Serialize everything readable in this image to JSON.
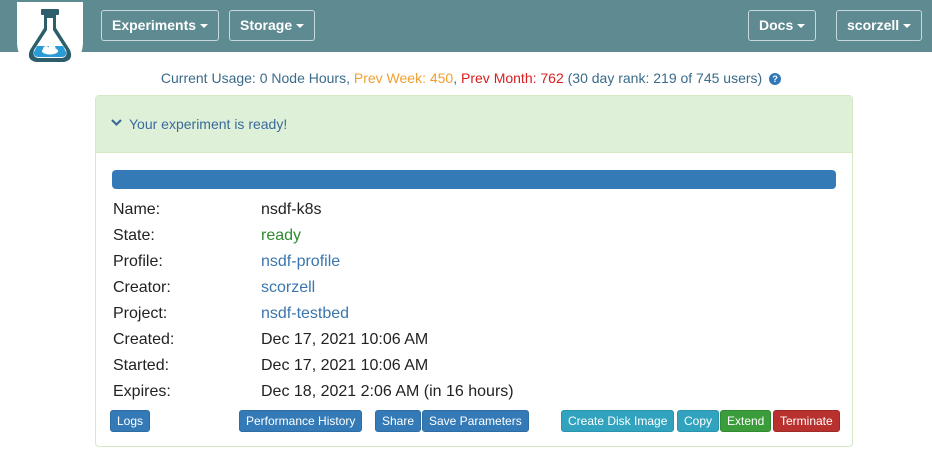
{
  "nav": {
    "experiments": "Experiments",
    "storage": "Storage",
    "docs": "Docs",
    "user": "scorzell"
  },
  "usage": {
    "current": "Current Usage: 0 Node Hours,",
    "prev_week": "Prev Week: 450",
    "prev_month": "Prev Month: 762",
    "rank": "(30 day rank: 219 of 745 users)"
  },
  "panel": {
    "status_title": "Your experiment is ready!",
    "progress_fraction": 1.0
  },
  "details": [
    {
      "label": "Name:",
      "value": "nsdf-k8s",
      "kind": "plain"
    },
    {
      "label": "State:",
      "value": "ready",
      "kind": "green"
    },
    {
      "label": "Profile:",
      "value": "nsdf-profile",
      "kind": "link"
    },
    {
      "label": "Creator:",
      "value": "scorzell",
      "kind": "link"
    },
    {
      "label": "Project:",
      "value": "nsdf-testbed",
      "kind": "link"
    },
    {
      "label": "Created:",
      "value": "Dec 17, 2021 10:06 AM",
      "kind": "plain"
    },
    {
      "label": "Started:",
      "value": "Dec 17, 2021 10:06 AM",
      "kind": "plain"
    },
    {
      "label": "Expires:",
      "value": "Dec 18, 2021 2:06 AM (in 16 hours)",
      "kind": "plain"
    }
  ],
  "actions": {
    "logs": "Logs",
    "performance_history": "Performance History",
    "share": "Share",
    "save_parameters": "Save Parameters",
    "create_disk_image": "Create Disk Image",
    "copy": "Copy",
    "extend": "Extend",
    "terminate": "Terminate"
  },
  "colors": {
    "navbar": "#5e8a91",
    "primary": "#337ab7",
    "info": "#31a3be",
    "success": "#3a9c3a",
    "danger": "#b8312e",
    "prev_week": "#f0a030",
    "prev_month": "#d82020"
  }
}
